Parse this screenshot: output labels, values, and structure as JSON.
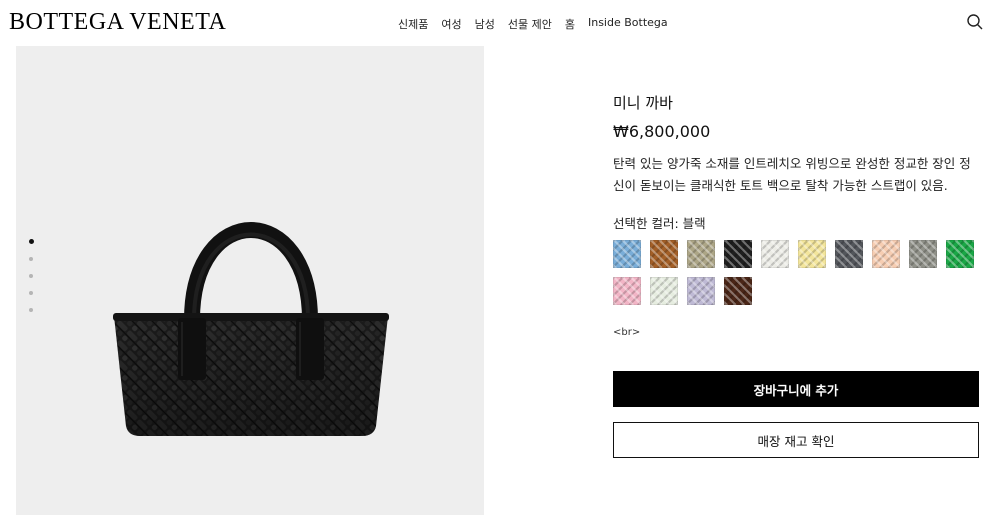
{
  "header": {
    "brand": "BOTTEGA VENETA",
    "nav": [
      "신제품",
      "여성",
      "남성",
      "선물 제안",
      "홈",
      "Inside Bottega"
    ]
  },
  "gallery": {
    "slide_count": 5,
    "active_slide": 1,
    "image": "black-woven-mini-tote"
  },
  "product": {
    "title": "미니 까바",
    "price": "₩6,800,000",
    "description": "탄력 있는 양가죽 소재를 인트레치오 위빙으로 완성한 정교한 장인 정신이 돋보이는 클래식한 토트 백으로 탈착 가능한 스트랩이 있음.",
    "color_label": "선택한 컬러: 블랙",
    "swatches": [
      "#79add8",
      "#a35f27",
      "#aca586",
      "#1f1f1f",
      "#ecece6",
      "#f3e59b",
      "#53565b",
      "#f6cdb2",
      "#8f9088",
      "#1aa746",
      "#f2b5c6",
      "#e6ede0",
      "#bfbad5",
      "#4b2617"
    ],
    "raw_markup": "<br>",
    "add_to_cart": "장바구니에 추가",
    "check_store": "매장 재고 확인"
  }
}
